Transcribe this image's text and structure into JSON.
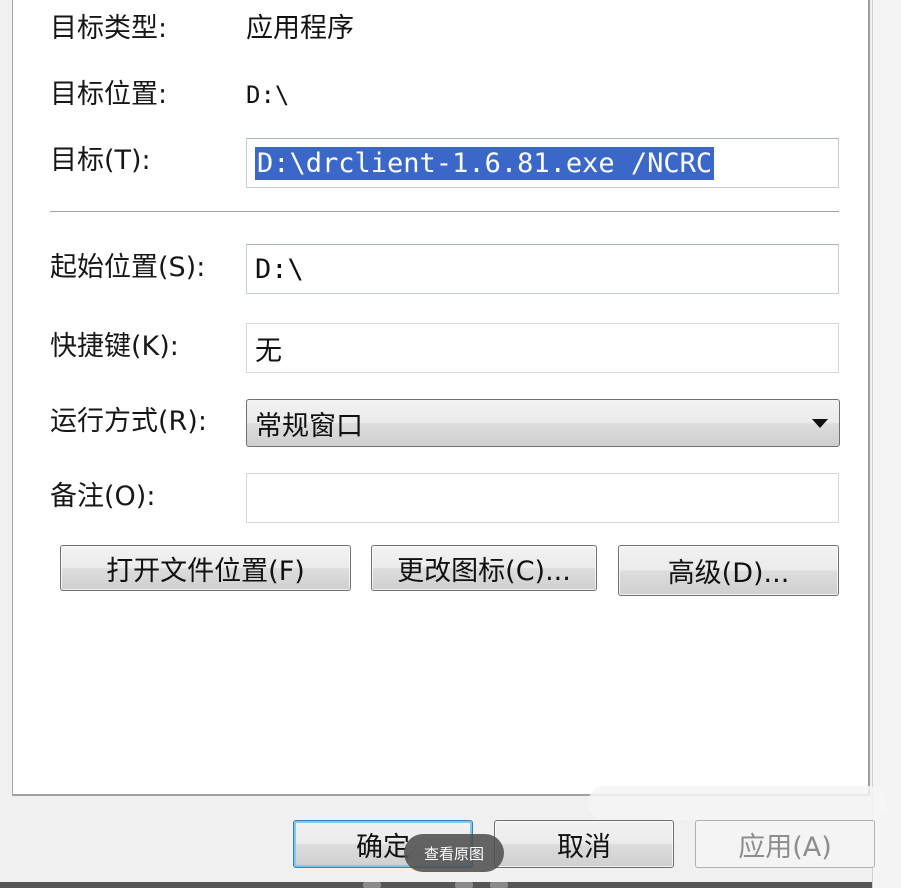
{
  "properties": {
    "target_type_label": "目标类型:",
    "target_type_value": "应用程序",
    "target_location_label": "目标位置:",
    "target_location_value": "D:\\",
    "target_label": "目标(T):",
    "target_value": "D:\\drclient-1.6.81.exe /NCRC",
    "start_in_label": "起始位置(S):",
    "start_in_value": "D:\\",
    "shortcut_key_label": "快捷键(K):",
    "shortcut_key_value": "无",
    "run_label": "运行方式(R):",
    "run_value": "常规窗口",
    "comment_label": "备注(O):",
    "comment_value": ""
  },
  "buttons": {
    "open_file_location": "打开文件位置(F)",
    "change_icon": "更改图标(C)...",
    "advanced": "高级(D)...",
    "ok": "确定",
    "cancel": "取消",
    "apply": "应用(A)"
  },
  "overlay": {
    "view_original": "查看原图"
  },
  "colors": {
    "selection": "#3b67c9",
    "default_button_border": "#3c7fb1"
  }
}
